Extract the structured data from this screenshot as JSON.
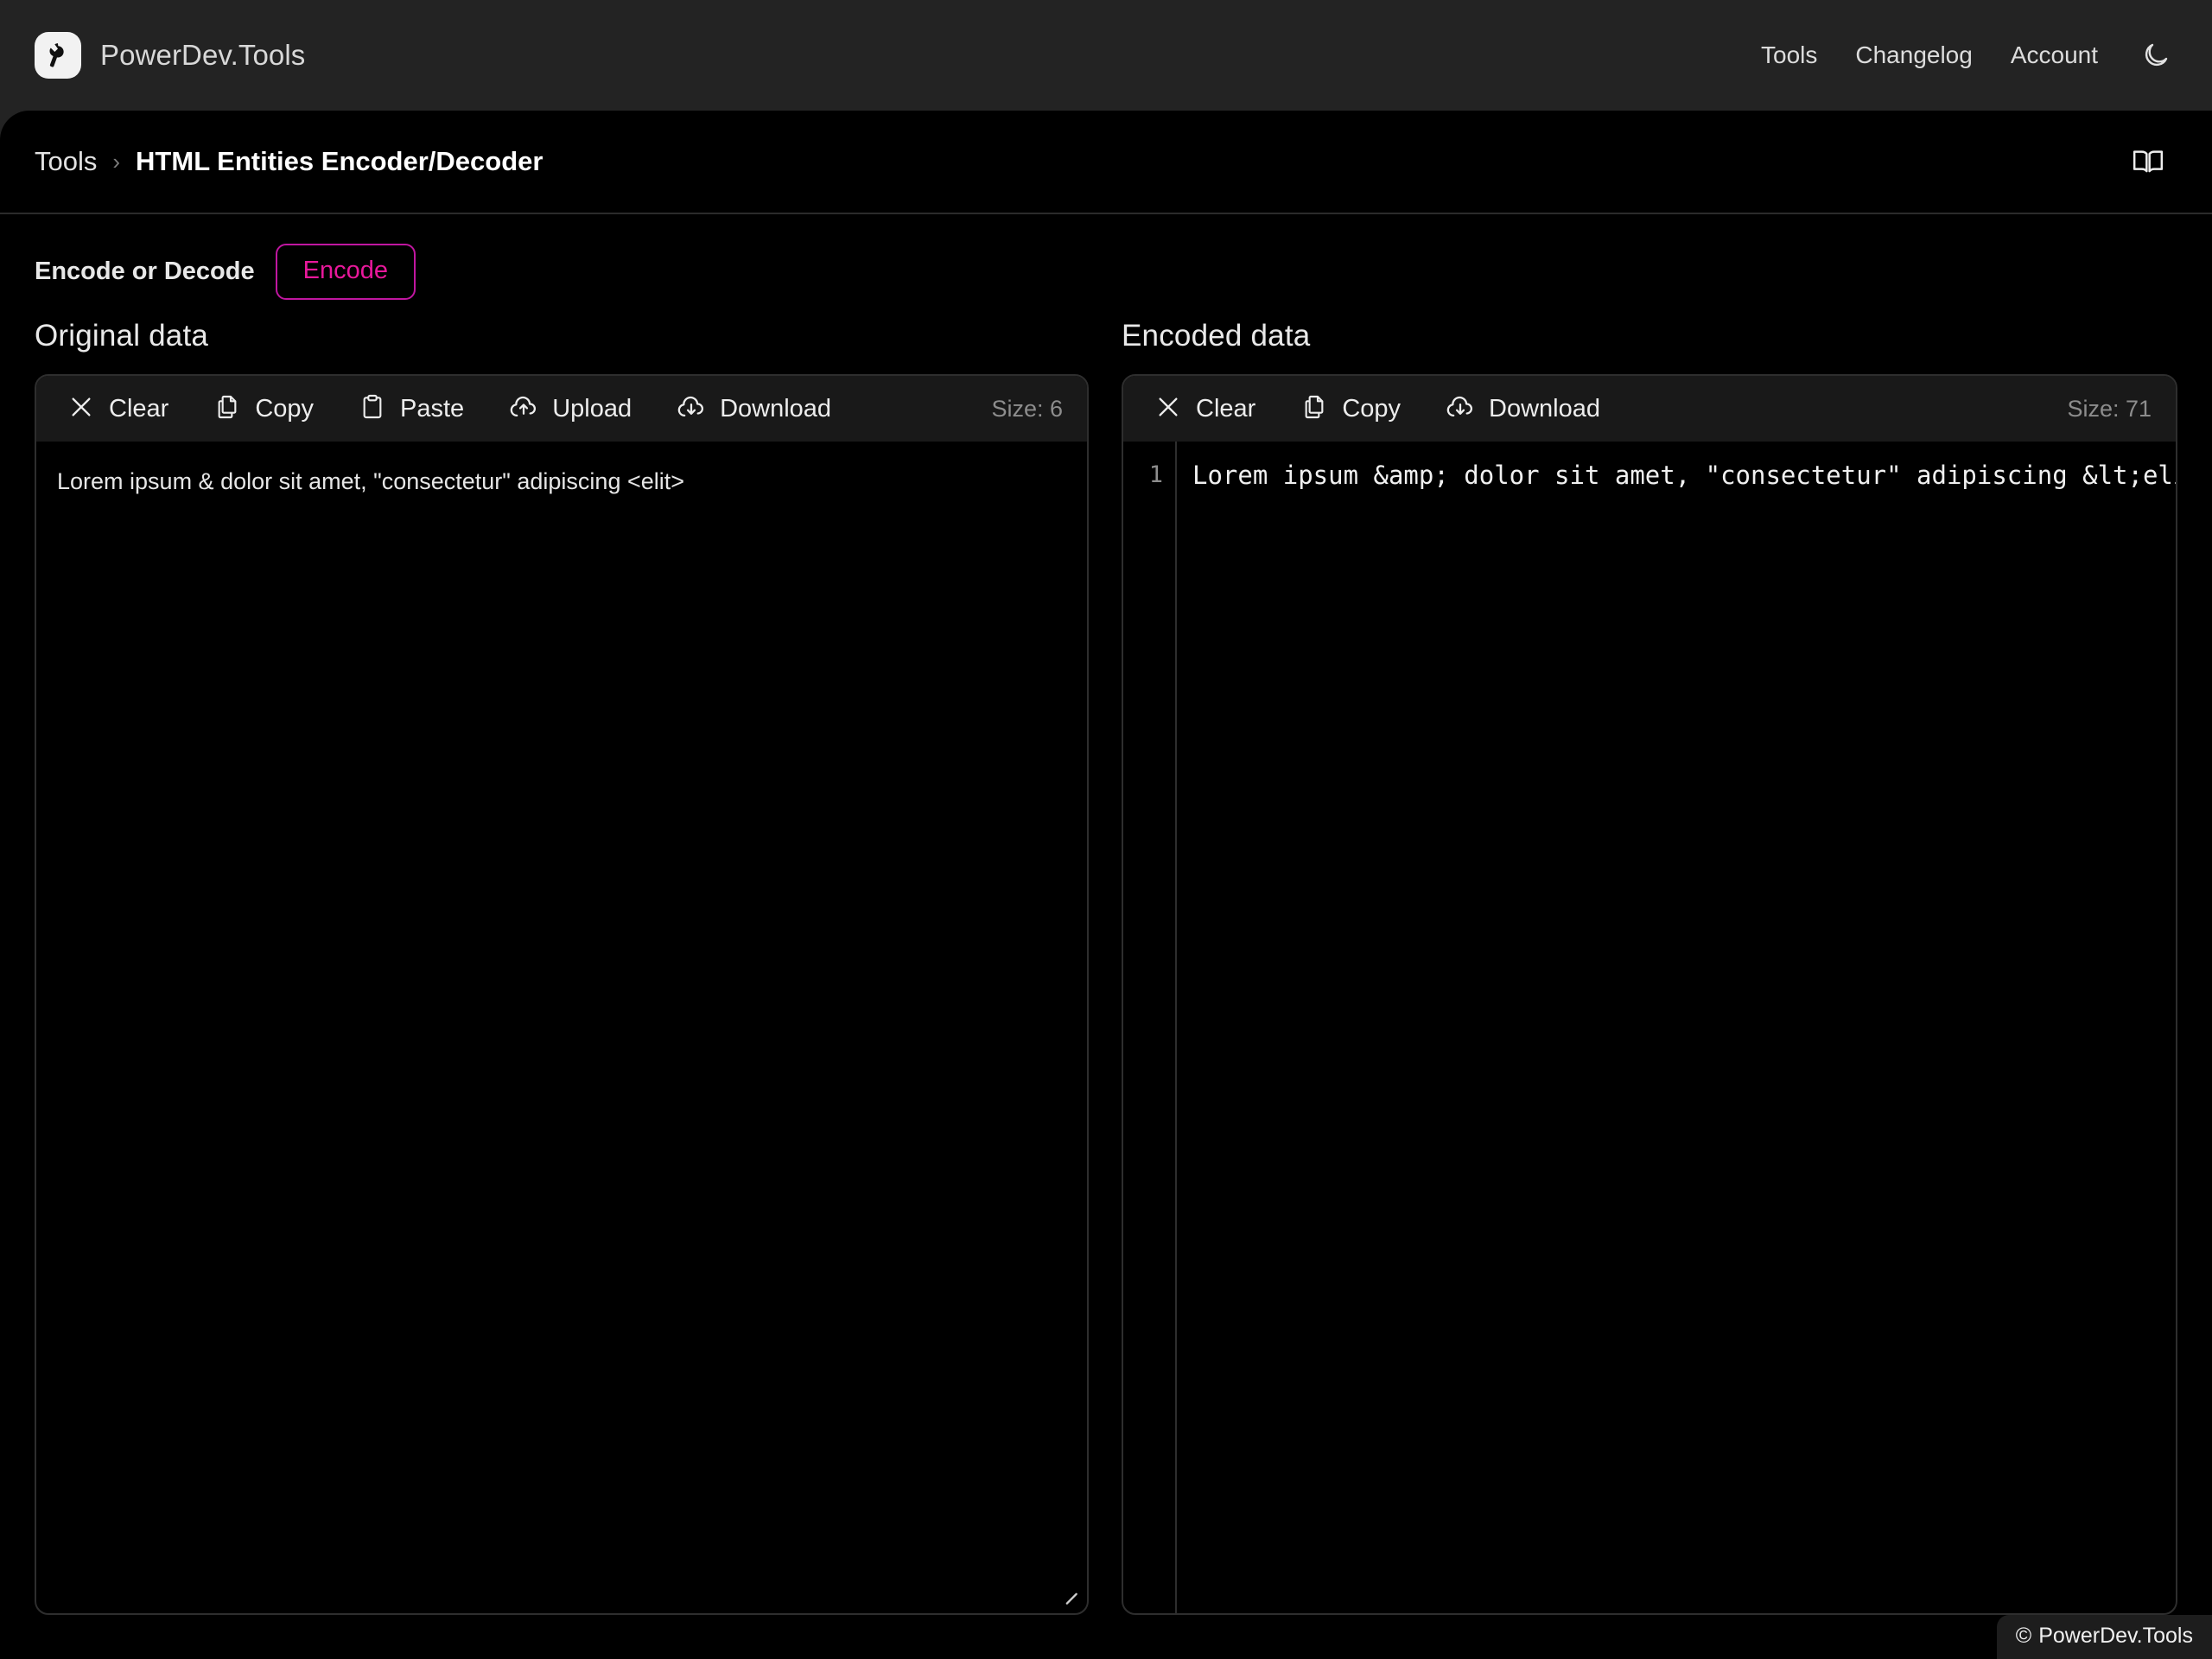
{
  "header": {
    "brand_name": "PowerDev.Tools",
    "logo_icon": "wrench-icon",
    "nav": [
      {
        "label": "Tools"
      },
      {
        "label": "Changelog"
      },
      {
        "label": "Account"
      }
    ],
    "theme_toggle_icon": "moon-icon"
  },
  "breadcrumb": {
    "parent": "Tools",
    "separator": "›",
    "current": "HTML Entities Encoder/Decoder",
    "docs_icon": "book-icon"
  },
  "mode": {
    "label": "Encode or Decode",
    "toggle_value": "Encode",
    "accent_color": "#e8189b"
  },
  "left_panel": {
    "title": "Original data",
    "toolbar": [
      {
        "label": "Clear",
        "icon": "close-icon"
      },
      {
        "label": "Copy",
        "icon": "copy-icon"
      },
      {
        "label": "Paste",
        "icon": "clipboard-icon"
      },
      {
        "label": "Upload",
        "icon": "cloud-upload-icon"
      },
      {
        "label": "Download",
        "icon": "cloud-download-icon"
      }
    ],
    "size_label": "Size: 6",
    "value": "Lorem ipsum & dolor sit amet, \"consectetur\" adipiscing <elit>",
    "placeholder": ""
  },
  "right_panel": {
    "title": "Encoded data",
    "toolbar": [
      {
        "label": "Clear",
        "icon": "close-icon"
      },
      {
        "label": "Copy",
        "icon": "copy-icon"
      },
      {
        "label": "Download",
        "icon": "cloud-download-icon"
      }
    ],
    "size_label": "Size: 71",
    "line_number": "1",
    "value": "Lorem ipsum &amp; dolor sit amet, \"consectetur\" adipiscing &lt;elit&gt;"
  },
  "footer": {
    "copyright_symbol": "©",
    "text": "PowerDev.Tools"
  }
}
